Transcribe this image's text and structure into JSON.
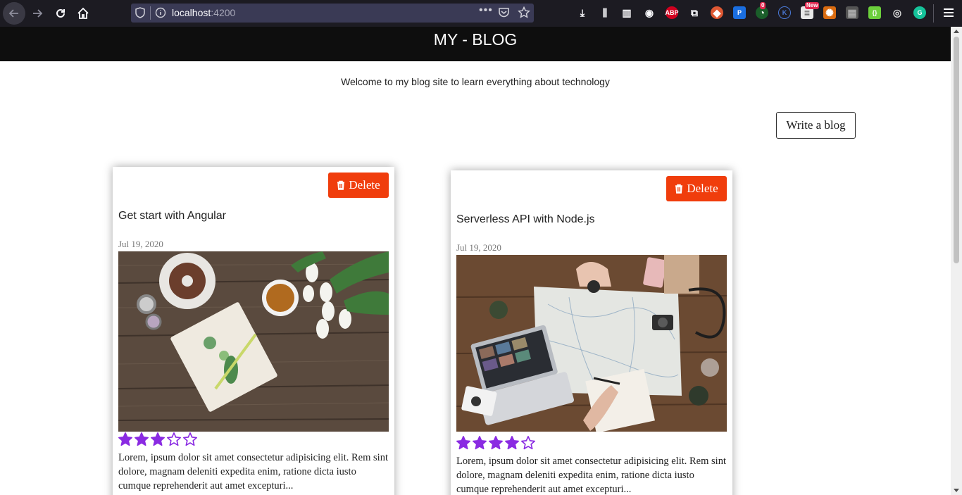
{
  "browser": {
    "url_host": "localhost",
    "url_port": ":4200",
    "extensions": [
      {
        "name": "download-icon"
      },
      {
        "name": "library-icon"
      },
      {
        "name": "sidebar-icon"
      },
      {
        "name": "account-icon"
      },
      {
        "name": "adblock-icon",
        "text": "ABP"
      },
      {
        "name": "screenshot-icon"
      },
      {
        "name": "duckduckgo-icon"
      },
      {
        "name": "pocket-p-icon",
        "text": "P"
      },
      {
        "name": "extension-green-icon",
        "badge": "0"
      },
      {
        "name": "k-extension-icon",
        "text": "K"
      },
      {
        "name": "news-extension-icon",
        "badge": "New"
      },
      {
        "name": "orange-extension-icon"
      },
      {
        "name": "gray-extension-icon"
      },
      {
        "name": "json-viewer-icon",
        "text": "{}"
      },
      {
        "name": "eye-extension-icon"
      },
      {
        "name": "grammarly-icon",
        "text": "G"
      }
    ]
  },
  "header": {
    "title": "MY - BLOG"
  },
  "welcome_text": "Welcome to my blog site to learn everything about technology",
  "write_button": "Write a blog",
  "posts": [
    {
      "delete_label": "Delete",
      "title": "Get start with Angular",
      "date": "Jul 19, 2020",
      "rating": 3,
      "max_rating": 5,
      "excerpt": "Lorem, ipsum dolor sit amet consectetur adipisicing elit. Rem sint dolore, magnam deleniti expedita enim, ratione dicta iusto cumque reprehenderit aut amet excepturi..."
    },
    {
      "delete_label": "Delete",
      "title": "Serverless API with Node.js",
      "date": "Jul 19, 2020",
      "rating": 4,
      "max_rating": 5,
      "excerpt": "Lorem, ipsum dolor sit amet consectetur adipisicing elit. Rem sint dolore, magnam deleniti expedita enim, ratione dicta iusto cumque reprehenderit aut amet excepturi..."
    }
  ],
  "colors": {
    "delete_button": "#f03d0c",
    "star": "#8a2be2",
    "header_bg": "#0e0e0e"
  }
}
